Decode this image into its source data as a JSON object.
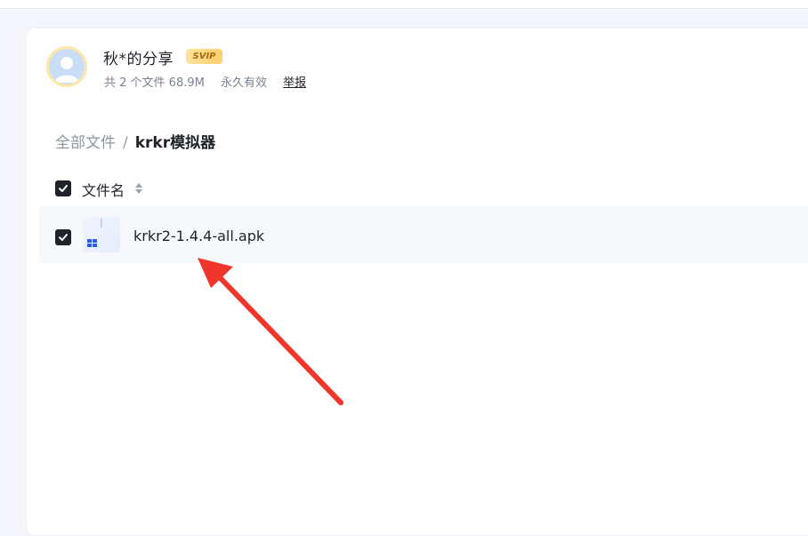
{
  "share": {
    "sharer_name": "秋*的分享",
    "badge": "SVIP",
    "file_count": "共 2 个文件 68.9M",
    "validity": "永久有效",
    "report_label": "举报"
  },
  "breadcrumb": {
    "root": "全部文件",
    "separator": "/",
    "current": "krkr模拟器"
  },
  "file_list": {
    "column_header": "文件名",
    "header_checked": true,
    "rows": [
      {
        "name": "krkr2-1.4.4-all.apk",
        "checked": true,
        "icon": "apk-file-icon"
      }
    ]
  },
  "annotation": {
    "arrow_color": "#f0362b"
  },
  "colors": {
    "background": "#f5f6fb",
    "card": "#ffffff",
    "checkbox": "#1f2329",
    "badge_gold": "#ffd27a"
  }
}
